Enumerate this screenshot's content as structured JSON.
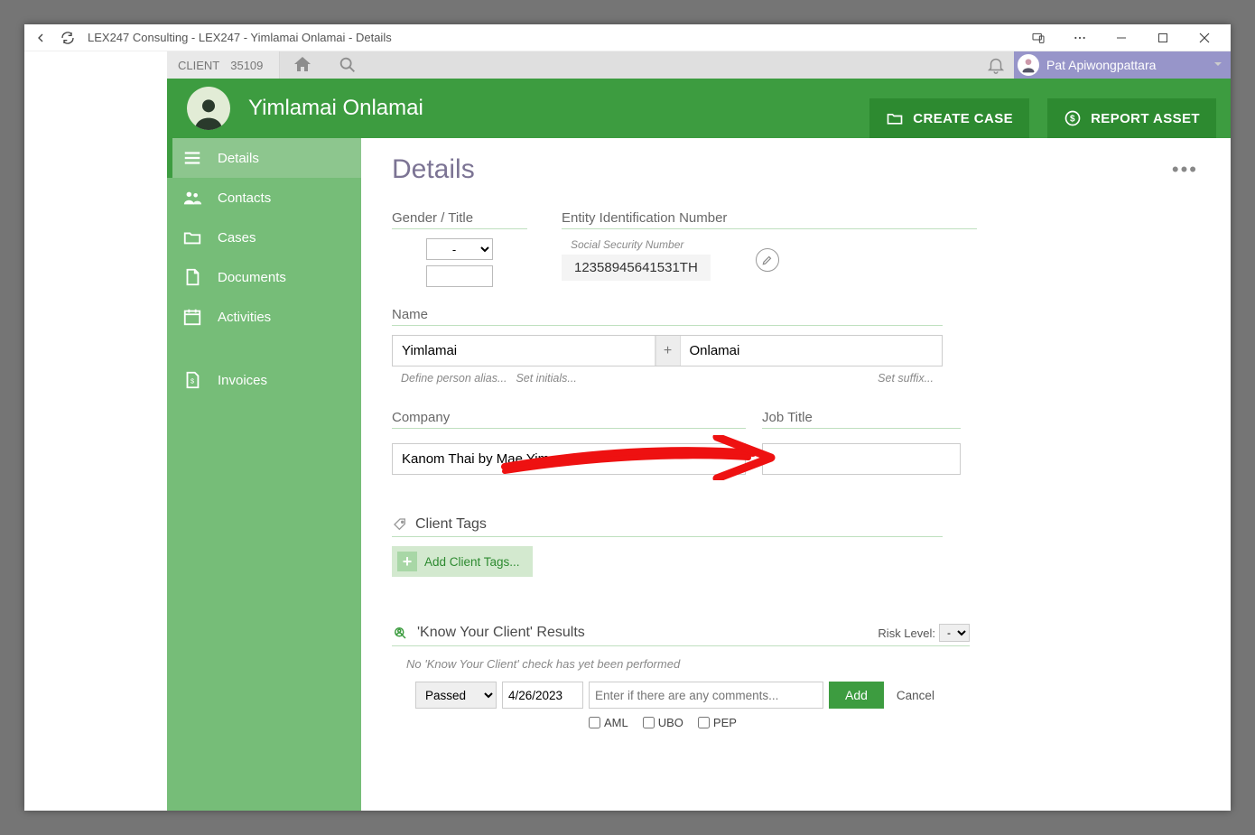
{
  "window": {
    "title": "LEX247 Consulting - LEX247 - Yimlamai Onlamai - Details"
  },
  "topbar": {
    "client_label": "CLIENT",
    "client_id": "35109",
    "user_name": "Pat Apiwongpattara"
  },
  "header": {
    "person_name": "Yimlamai Onlamai",
    "create_case": "CREATE CASE",
    "report_asset": "REPORT ASSET"
  },
  "sidebar": {
    "items": [
      {
        "label": "Details"
      },
      {
        "label": "Contacts"
      },
      {
        "label": "Cases"
      },
      {
        "label": "Documents"
      },
      {
        "label": "Activities"
      },
      {
        "label": "Invoices"
      }
    ]
  },
  "page": {
    "title": "Details",
    "gender_label": "Gender / Title",
    "gender_value": "-",
    "ein_label": "Entity Identification Number",
    "ssn_label": "Social Security Number",
    "ssn_value": "12358945641531TH",
    "name_label": "Name",
    "first_name": "Yimlamai",
    "last_name": "Onlamai",
    "alias_hint": "Define person alias...",
    "initials_hint": "Set initials...",
    "suffix_hint": "Set suffix...",
    "company_label": "Company",
    "company_value": "Kanom Thai by Mae Yim",
    "jobtitle_label": "Job Title",
    "jobtitle_value": "",
    "tags_label": "Client Tags",
    "add_tags": "Add Client Tags...",
    "kyc_label": "'Know Your Client' Results",
    "risk_label": "Risk Level:",
    "risk_value": "-",
    "kyc_note": "No 'Know Your Client' check has yet been performed",
    "kyc_status": "Passed",
    "kyc_date": "4/26/2023",
    "kyc_comments_placeholder": "Enter if there are any comments...",
    "kyc_add": "Add",
    "kyc_cancel": "Cancel",
    "kyc_aml": "AML",
    "kyc_ubo": "UBO",
    "kyc_pep": "PEP"
  }
}
